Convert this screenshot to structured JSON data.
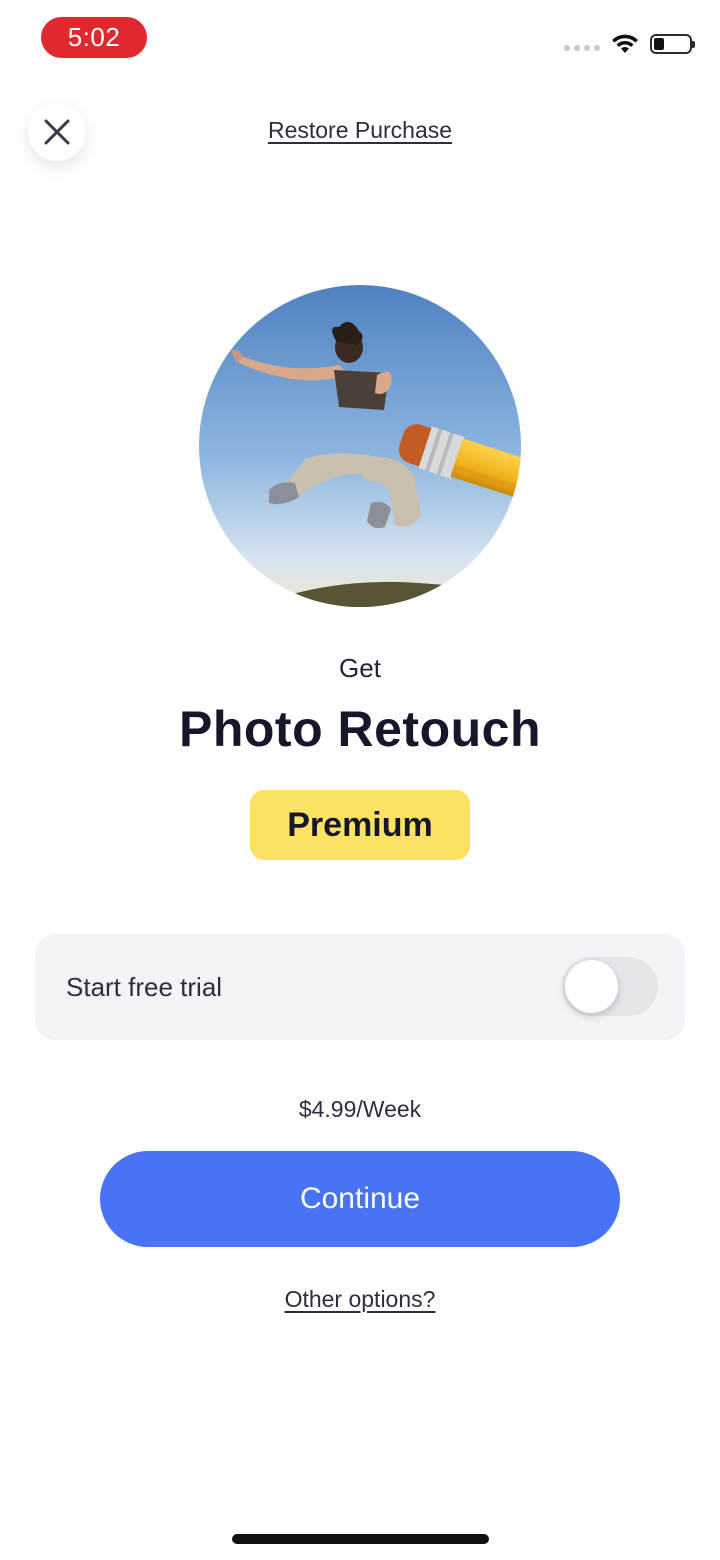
{
  "status_bar": {
    "time": "5:02",
    "time_pill_color": "#e0282e",
    "icons": [
      "signal-dots-icon",
      "wifi-icon",
      "battery-icon"
    ]
  },
  "header": {
    "close_icon": "close-icon",
    "restore_label": "Restore Purchase"
  },
  "hero": {
    "icon": "retouch-photo-illustration"
  },
  "content": {
    "get_label": "Get",
    "title": "Photo Retouch",
    "badge_label": "Premium",
    "badge_color": "#fde264"
  },
  "trial": {
    "label": "Start free trial",
    "enabled": false
  },
  "pricing": {
    "price_label": "$4.99/Week"
  },
  "actions": {
    "continue_label": "Continue",
    "continue_color": "#4a72f5",
    "other_options_label": "Other options?"
  }
}
